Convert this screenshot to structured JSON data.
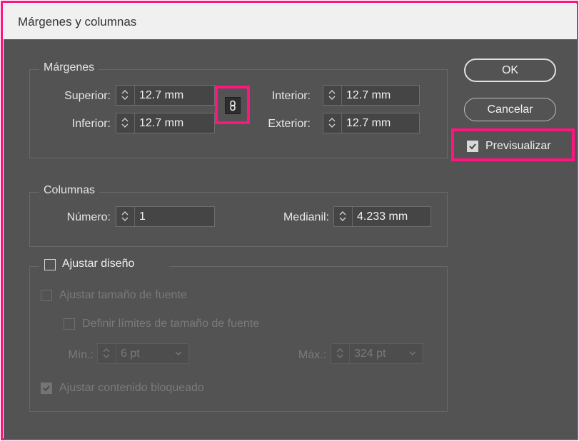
{
  "dialog": {
    "title": "Márgenes y columnas"
  },
  "margins": {
    "legend": "Márgenes",
    "superior": {
      "label": "Superior:",
      "value": "12.7 mm"
    },
    "inferior": {
      "label": "Inferior:",
      "value": "12.7 mm"
    },
    "interior": {
      "label": "Interior:",
      "value": "12.7 mm"
    },
    "exterior": {
      "label": "Exterior:",
      "value": "12.7 mm"
    },
    "link_icon": "chain-link-icon"
  },
  "columns": {
    "legend": "Columnas",
    "numero": {
      "label": "Número:",
      "value": "1"
    },
    "medianil": {
      "label": "Medianil:",
      "value": "4.233 mm"
    }
  },
  "adjust": {
    "legend": "Ajustar diseño",
    "legend_checked": false,
    "font_size": {
      "label": "Ajustar tamaño de fuente",
      "checked": false
    },
    "font_limits": {
      "label": "Definir límites de tamaño de fuente",
      "checked": false
    },
    "min": {
      "label": "Mín.:",
      "value": "6 pt"
    },
    "max": {
      "label": "Máx.:",
      "value": "324 pt"
    },
    "locked": {
      "label": "Ajustar contenido bloqueado",
      "checked": true
    }
  },
  "buttons": {
    "ok": "OK",
    "cancel": "Cancelar"
  },
  "preview": {
    "label": "Previsualizar",
    "checked": true
  },
  "colors": {
    "dialog_bg": "#535353",
    "titlebar_bg": "#f0f0f0",
    "highlight": "#ff1480"
  }
}
